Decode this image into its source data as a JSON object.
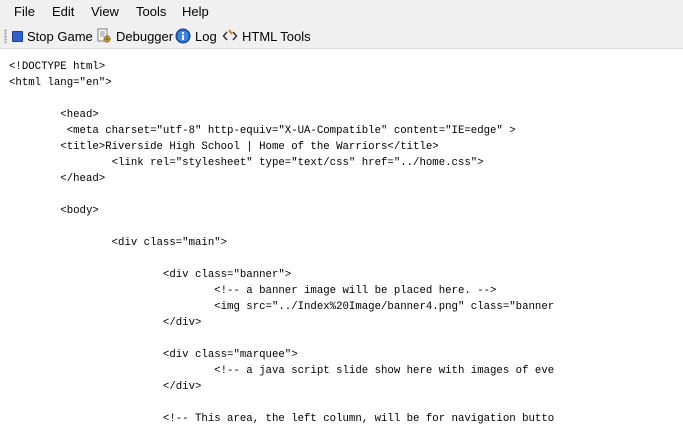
{
  "menu": {
    "items": [
      "File",
      "Edit",
      "View",
      "Tools",
      "Help"
    ]
  },
  "toolbar": {
    "stop_game": "Stop Game",
    "debugger": "Debugger",
    "log": "Log",
    "html_tools": "HTML Tools"
  },
  "icons": {
    "stop": "stop-square-icon",
    "debugger": "debugger-icon",
    "log": "info-icon",
    "html_tools": "html-tools-icon"
  },
  "colors": {
    "stop_icon": "#2d63c8",
    "info_icon": "#1f5fbf"
  },
  "code_lines": [
    "<!DOCTYPE html>",
    "<html lang=\"en\">",
    "",
    "        <head>",
    "         <meta charset=\"utf-8\" http-equiv=\"X-UA-Compatible\" content=\"IE=edge\" >",
    "        <title>Riverside High School | Home of the Warriors</title>",
    "                <link rel=\"stylesheet\" type=\"text/css\" href=\"../home.css\">",
    "        </head>",
    "",
    "        <body>",
    "",
    "                <div class=\"main\">",
    "",
    "                        <div class=\"banner\">",
    "                                <!-- a banner image will be placed here. -->",
    "                                <img src=\"../Index%20Image/banner4.png\" class=\"banner",
    "                        </div>",
    "",
    "                        <div class=\"marquee\">",
    "                                <!-- a java script slide show here with images of eve",
    "                        </div>",
    "",
    "                        <!-- This area, the left column, will be for navigation butto"
  ]
}
